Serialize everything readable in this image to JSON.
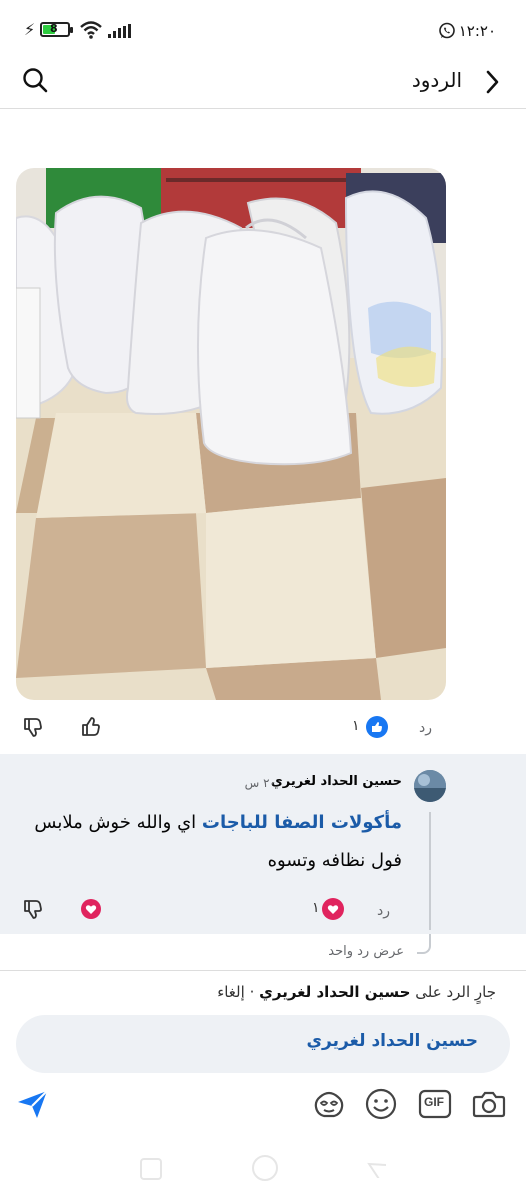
{
  "status": {
    "time": "١٢:٢٠",
    "battery": "8"
  },
  "header": {
    "title": "الردود"
  },
  "post": {
    "reply_label": "رد",
    "reaction_count": "١"
  },
  "comment": {
    "author": "حسين الحداد لغريري",
    "time": "٢٠ س",
    "mention": "مأكولات الصفا للباجات",
    "text": " اي والله خوش ملابس فول نظافه وتسوه",
    "reply_label": "رد",
    "reaction_count": "١",
    "view_replies": "عرض رد واحد"
  },
  "replying": {
    "prefix": "جارٍ الرد على ",
    "name": "حسين الحداد لغريري",
    "separator": " · ",
    "cancel": "إلغاء"
  },
  "composer": {
    "value": "حسين الحداد لغريري"
  },
  "toolbar": {
    "gif_label": "GIF"
  },
  "colors": {
    "accent": "#1877f2",
    "mention": "#1b5ba8",
    "heart": "#e0245e",
    "send": "#1877f2"
  }
}
